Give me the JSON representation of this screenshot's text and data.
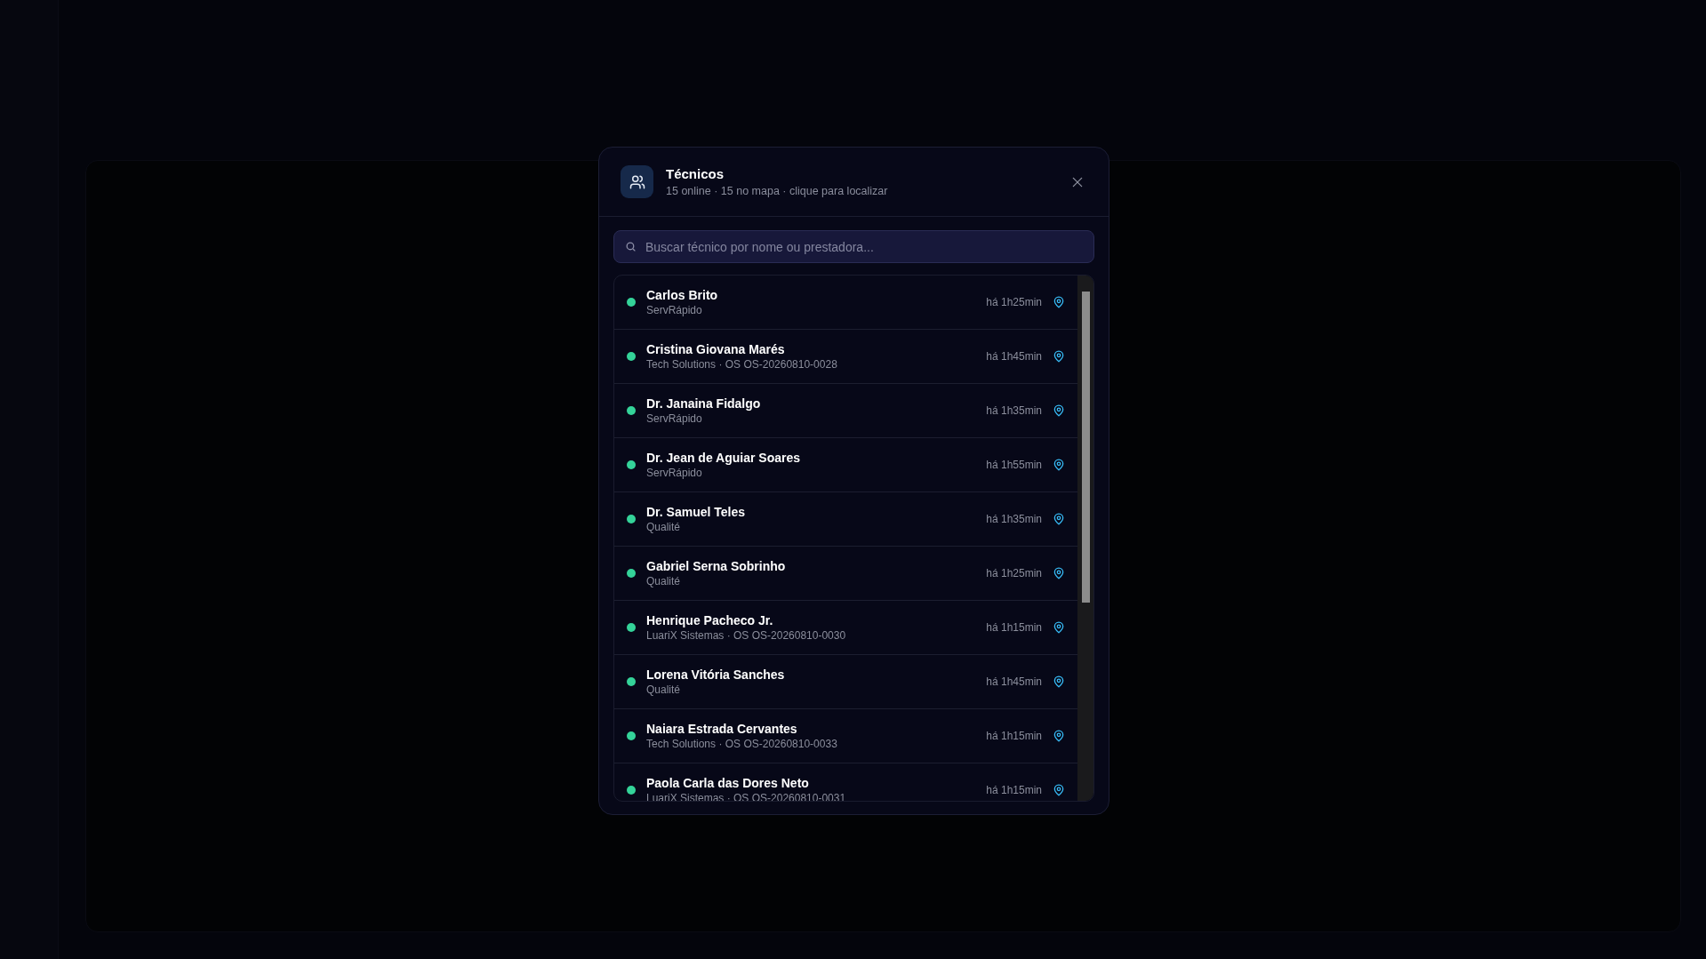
{
  "dialog": {
    "title": "Técnicos",
    "subtitle": "15 online · 15 no mapa · clique para localizar",
    "search": {
      "placeholder": "Buscar técnico por nome ou prestadora..."
    },
    "technicians": [
      {
        "name": "Carlos Brito",
        "detail": "ServRápido",
        "last_seen": "há 1h25min",
        "online": true
      },
      {
        "name": "Cristina Giovana Marés",
        "detail": "Tech Solutions · OS OS-20260810-0028",
        "last_seen": "há 1h45min",
        "online": true
      },
      {
        "name": "Dr. Janaina Fidalgo",
        "detail": "ServRápido",
        "last_seen": "há 1h35min",
        "online": true
      },
      {
        "name": "Dr. Jean de Aguiar Soares",
        "detail": "ServRápido",
        "last_seen": "há 1h55min",
        "online": true
      },
      {
        "name": "Dr. Samuel Teles",
        "detail": "Qualité",
        "last_seen": "há 1h35min",
        "online": true
      },
      {
        "name": "Gabriel Serna Sobrinho",
        "detail": "Qualité",
        "last_seen": "há 1h25min",
        "online": true
      },
      {
        "name": "Henrique Pacheco Jr.",
        "detail": "LuariX Sistemas · OS OS-20260810-0030",
        "last_seen": "há 1h15min",
        "online": true
      },
      {
        "name": "Lorena Vitória Sanches",
        "detail": "Qualité",
        "last_seen": "há 1h45min",
        "online": true
      },
      {
        "name": "Naiara Estrada Cervantes",
        "detail": "Tech Solutions · OS OS-20260810-0033",
        "last_seen": "há 1h15min",
        "online": true
      },
      {
        "name": "Paola Carla das Dores Neto",
        "detail": "LuariX Sistemas · OS OS-20260810-0031",
        "last_seen": "há 1h15min",
        "online": true
      }
    ]
  }
}
